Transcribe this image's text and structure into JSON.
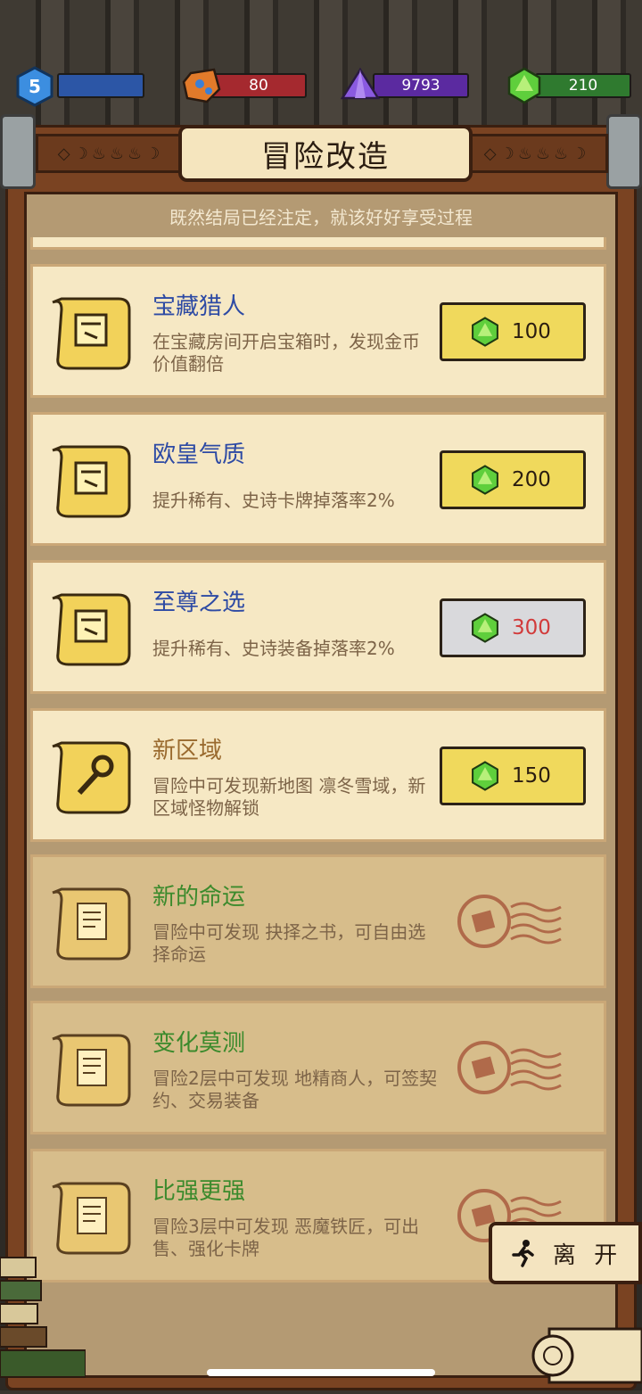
{
  "resources": {
    "level": "5",
    "red_gem": "80",
    "purple_crystal": "9793",
    "green_gem": "210"
  },
  "header": {
    "title": "冒险改造",
    "subtitle": "既然结局已经注定，就该好好享受过程"
  },
  "upgrades": [
    {
      "title": "宝藏猎人",
      "desc": "在宝藏房间开启宝箱时，发现金币 价值翻倍",
      "price": "100",
      "state": "buy",
      "icon": "rune-scroll-icon"
    },
    {
      "title": "欧皇气质",
      "desc": "提升稀有、史诗卡牌掉落率2%",
      "price": "200",
      "state": "buy",
      "icon": "rune-scroll-icon"
    },
    {
      "title": "至尊之选",
      "desc": "提升稀有、史诗装备掉落率2%",
      "price": "300",
      "state": "unaffordable",
      "icon": "rune-scroll-icon"
    },
    {
      "title": "新区域",
      "desc": "冒险中可发现新地图 凛冬雪域，新区域怪物解锁",
      "price": "150",
      "state": "buy",
      "icon": "wrench-scroll-icon"
    },
    {
      "title": "新的命运",
      "desc": "冒险中可发现 抉择之书，可自由选择命运",
      "state": "owned",
      "icon": "document-scroll-icon"
    },
    {
      "title": "变化莫测",
      "desc": "冒险2层中可发现 地精商人，可签契约、交易装备",
      "state": "owned",
      "icon": "document-scroll-icon"
    },
    {
      "title": "比强更强",
      "desc": "冒险3层中可发现 恶魔铁匠，可出售、强化卡牌",
      "state": "owned",
      "icon": "document-scroll-icon"
    }
  ],
  "footer": {
    "leave_label": "离 开"
  }
}
